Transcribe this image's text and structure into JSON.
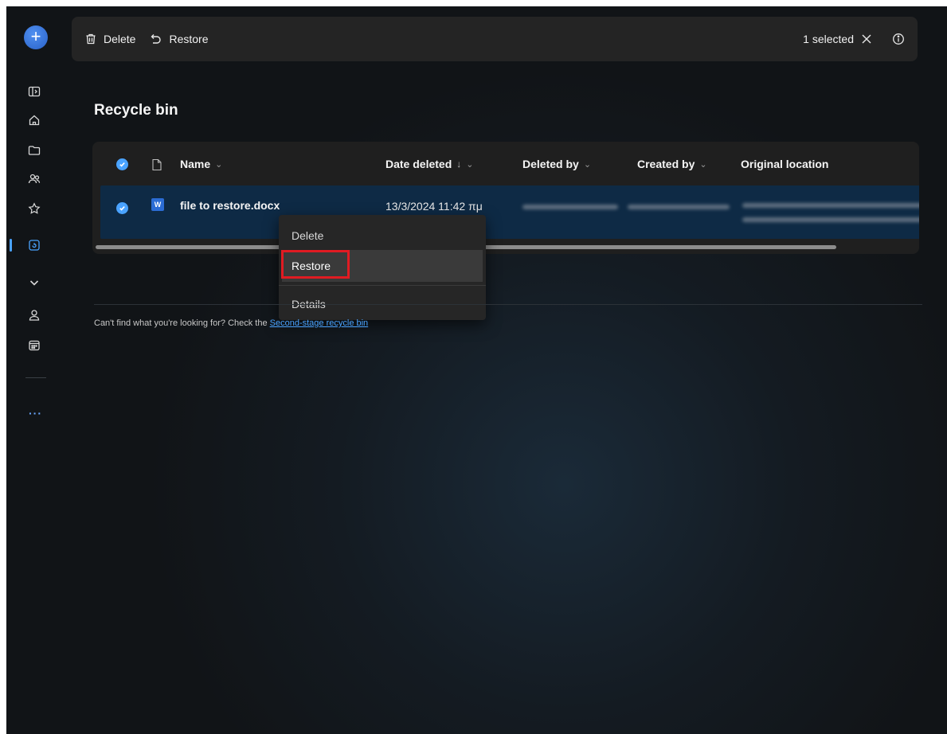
{
  "toolbar": {
    "delete_label": "Delete",
    "restore_label": "Restore",
    "selection_text": "1 selected"
  },
  "page": {
    "title": "Recycle bin"
  },
  "table": {
    "columns": {
      "name": "Name",
      "date_deleted": "Date deleted",
      "deleted_by": "Deleted by",
      "created_by": "Created by",
      "original_location": "Original location"
    },
    "sort_indicator": "↓",
    "rows": [
      {
        "name": "file to restore.docx",
        "date_deleted": "13/3/2024 11:42 πμ",
        "selected": true
      }
    ]
  },
  "context_menu": {
    "items": [
      "Delete",
      "Restore",
      "Details"
    ],
    "highlighted": "Restore"
  },
  "footer": {
    "hint_text": "Can't find what you're looking for? Check the ",
    "hint_link": "Second-stage recycle bin"
  },
  "colors": {
    "accent": "#4aa3ff",
    "selected_row": "#0e2a45",
    "highlight_box": "#e01b22"
  },
  "icons": {
    "rail": [
      "plus-icon",
      "sidebar-toggle-icon",
      "home-icon",
      "folder-icon",
      "people-icon",
      "star-icon",
      "recycle-bin-icon",
      "chevron-down-icon",
      "person-icon",
      "calendar-icon",
      "more-icon"
    ]
  }
}
